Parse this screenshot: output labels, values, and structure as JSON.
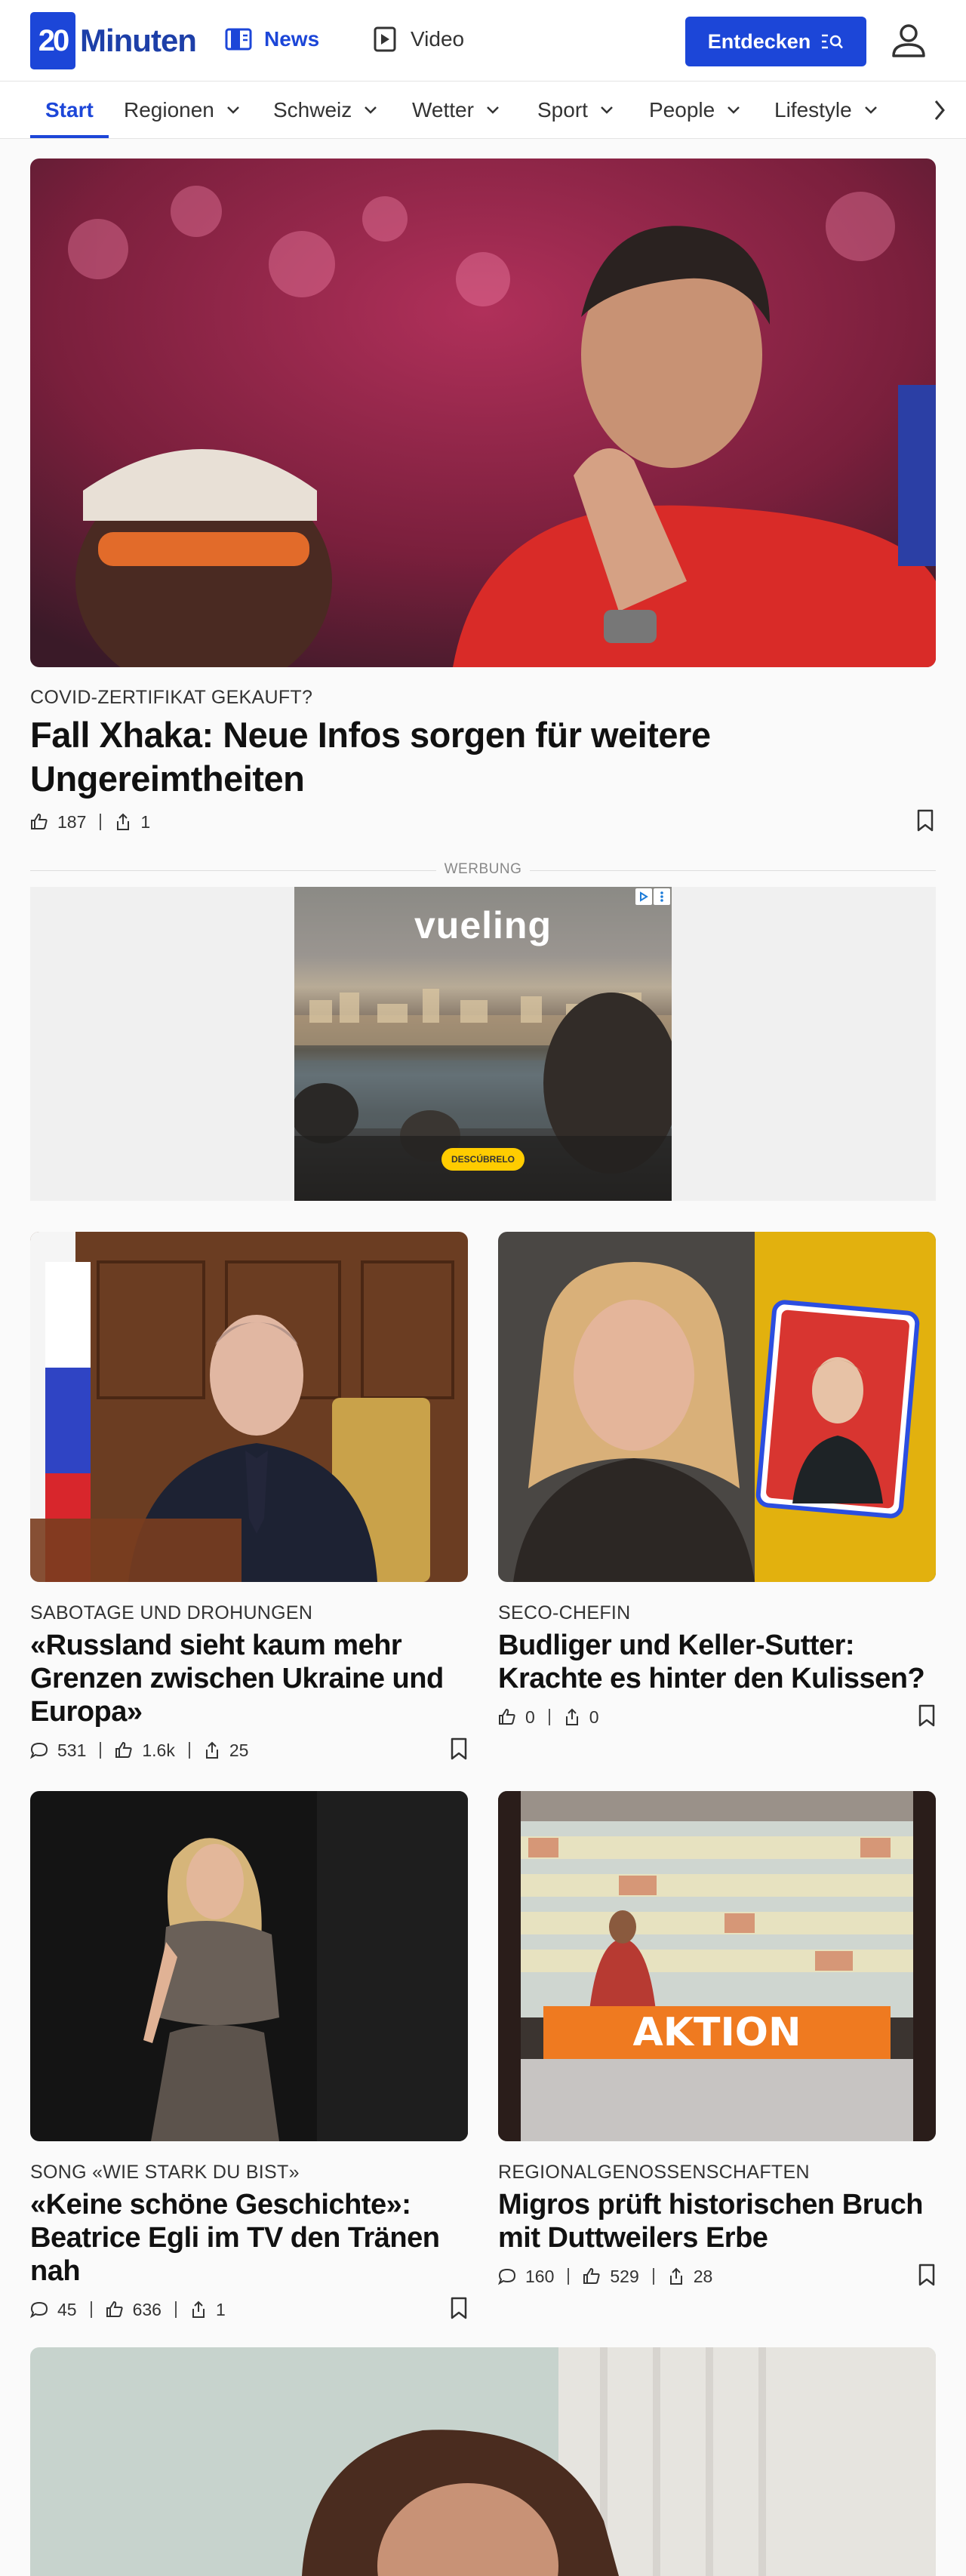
{
  "header": {
    "logo_text": "Minuten",
    "logo_mark": "20",
    "nav_news": "News",
    "nav_video": "Video",
    "entdecken": "Entdecken",
    "icons": [
      "news-icon",
      "video-play-icon",
      "search-list-icon",
      "user-icon"
    ]
  },
  "categories": [
    {
      "label": "Start",
      "active": true
    },
    {
      "label": "Regionen"
    },
    {
      "label": "Schweiz"
    },
    {
      "label": "Wetter"
    },
    {
      "label": "Sport"
    },
    {
      "label": "People"
    },
    {
      "label": "Lifestyle"
    }
  ],
  "hero": {
    "kicker": "COVID-ZERTIFIKAT GEKAUFT?",
    "headline": "Fall Xhaka: Neue Infos sorgen für weitere Ungereimtheiten",
    "likes": "187",
    "shares": "1"
  },
  "ad": {
    "label": "WERBUNG",
    "brand": "vueling",
    "cta": "DESCÚBRELO"
  },
  "articles": [
    {
      "kicker": "SABOTAGE UND DROHUNGEN",
      "headline": "«Russland sieht kaum mehr Grenzen zwischen Ukraine und Europa»",
      "comments": "531",
      "likes": "1.6k",
      "shares": "25"
    },
    {
      "kicker": "SECO-CHEFIN",
      "headline": "Budliger und Keller-Sutter: Krachte es hinter den Kulissen?",
      "likes": "0",
      "shares": "0"
    },
    {
      "kicker": "SONG «WIE STARK DU BIST»",
      "headline": "«Keine schöne Geschichte»: Beatrice Egli im TV den Tränen nah",
      "comments": "45",
      "likes": "636",
      "shares": "1"
    },
    {
      "kicker": "REGIONALGENOSSENSCHAFTEN",
      "headline": "Migros prüft historischen Bruch mit Duttweilers Erbe",
      "comments": "160",
      "likes": "529",
      "shares": "28"
    }
  ],
  "image_texts": {
    "aktion": "AKTION"
  },
  "colors": {
    "brand": "#1c46d8",
    "ad_cta": "#ffcc00"
  }
}
